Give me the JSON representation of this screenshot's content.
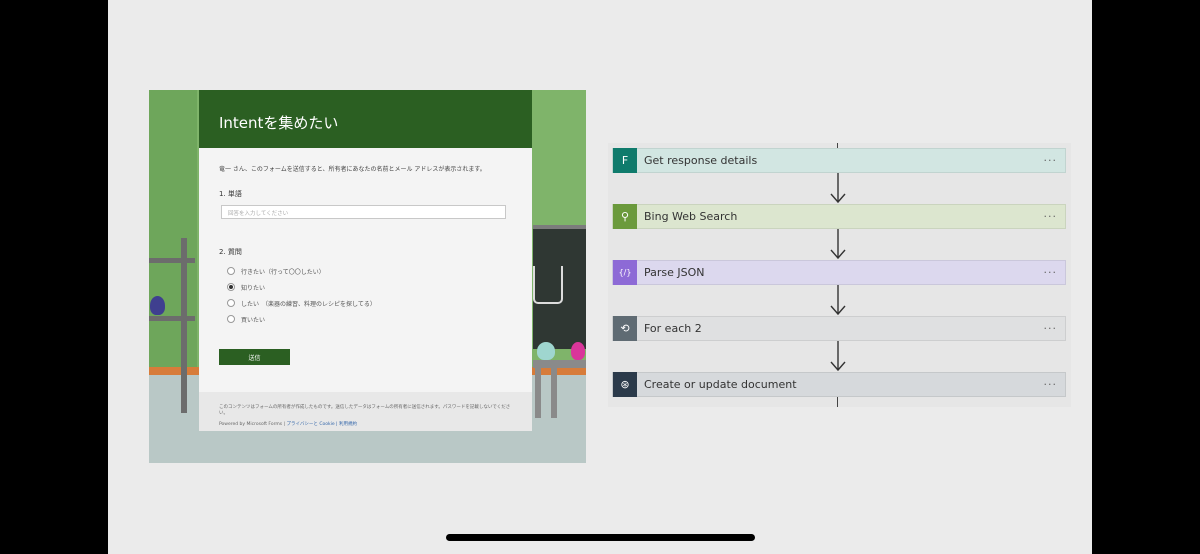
{
  "forms": {
    "title": "Intentを集めたい",
    "intro": "竜一 さん、このフォームを送信すると、所有者にあなたの名前とメール アドレスが表示されます。",
    "q1_label": "1. 単語",
    "q1_placeholder": "回答を入力してください",
    "q2_label": "2. 質問",
    "options": [
      {
        "label": "行きたい（行って〇〇したい）",
        "checked": false
      },
      {
        "label": "知りたい",
        "checked": true
      },
      {
        "label": "したい　（楽器の練習、料理のレシピを探してる）",
        "checked": false
      },
      {
        "label": "買いたい",
        "checked": false
      }
    ],
    "submit": "送信",
    "footer_line1": "このコンテンツはフォームの所有者が作成したものです。送信したデータはフォームの所有者に送信されます。パスワードを記載しないでください。",
    "footer_powered": "Powered by Microsoft Forms |",
    "footer_links": "プライバシーと Cookie | 利用規約"
  },
  "flow": {
    "steps": [
      {
        "title": "Get response details",
        "icon": "forms-icon",
        "glyph": "F",
        "color": "#d2e6e2",
        "icon_color": "#0f7b6c"
      },
      {
        "title": "Bing Web Search",
        "icon": "bing-search-icon",
        "glyph": "⚲",
        "color": "#dce6cf",
        "icon_color": "#6b9a3c"
      },
      {
        "title": "Parse JSON",
        "icon": "parse-json-icon",
        "glyph": "{/}",
        "color": "#dcd8ee",
        "icon_color": "#8d6ad6"
      },
      {
        "title": "For each 2",
        "icon": "loop-icon",
        "glyph": "⟲",
        "color": "#dfe0e1",
        "icon_color": "#5f6b73"
      },
      {
        "title": "Create or update document",
        "icon": "cosmos-db-icon",
        "glyph": "⊛",
        "color": "#d6d9dc",
        "icon_color": "#2b3a4a"
      }
    ],
    "more_glyph": "···"
  }
}
